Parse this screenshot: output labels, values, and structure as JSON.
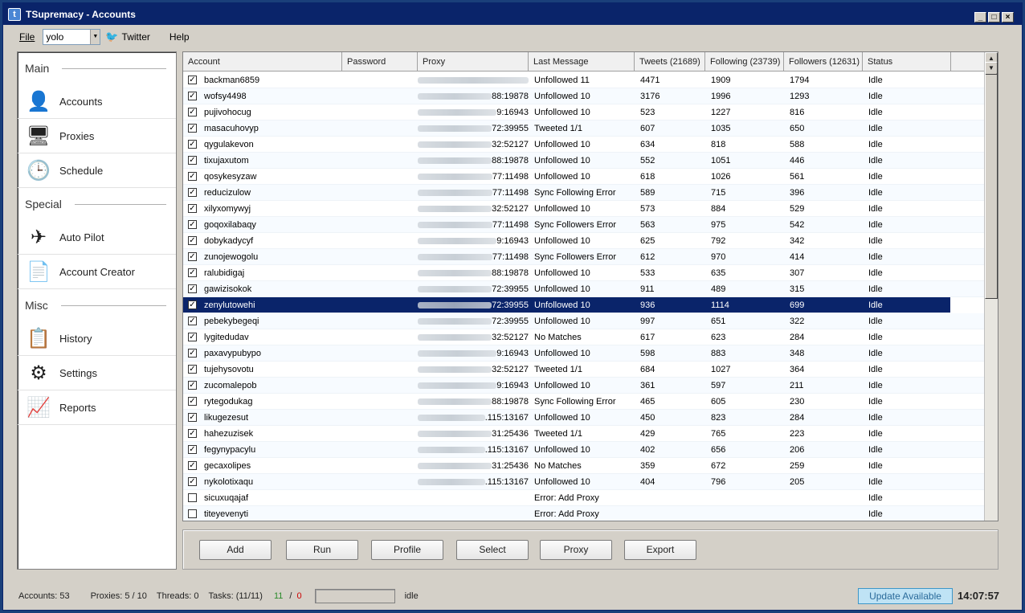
{
  "window": {
    "title": "TSupremacy - Accounts",
    "icon": "t-icon"
  },
  "menu": {
    "file": "File",
    "profile_value": "yolo",
    "twitter": "Twitter",
    "help": "Help"
  },
  "sidebar": {
    "sections": [
      {
        "title": "Main",
        "items": [
          {
            "label": "Accounts",
            "icon": "user-icon"
          },
          {
            "label": "Proxies",
            "icon": "computer-icon"
          },
          {
            "label": "Schedule",
            "icon": "clock-icon"
          }
        ]
      },
      {
        "title": "Special",
        "items": [
          {
            "label": "Auto Pilot",
            "icon": "airplane-icon"
          },
          {
            "label": "Account Creator",
            "icon": "documents-icon"
          }
        ]
      },
      {
        "title": "Misc",
        "items": [
          {
            "label": "History",
            "icon": "clipboard-icon"
          },
          {
            "label": "Settings",
            "icon": "gears-icon"
          },
          {
            "label": "Reports",
            "icon": "chart-icon"
          }
        ]
      }
    ]
  },
  "grid": {
    "columns": [
      "Account",
      "Password",
      "Proxy",
      "Last Message",
      "Tweets (21689)",
      "Following (23739)",
      "Followers (12631)",
      "Status"
    ],
    "rows": [
      {
        "checked": true,
        "account": "backman6859",
        "proxy": "",
        "message": "Unfollowed 11",
        "tweets": "4471",
        "following": "1909",
        "followers": "1794",
        "status": "Idle"
      },
      {
        "checked": true,
        "account": "wofsy4498",
        "proxy": "88:19878",
        "message": "Unfollowed 10",
        "tweets": "3176",
        "following": "1996",
        "followers": "1293",
        "status": "Idle"
      },
      {
        "checked": true,
        "account": "pujivohocug",
        "proxy": "9:16943",
        "message": "Unfollowed 10",
        "tweets": "523",
        "following": "1227",
        "followers": "816",
        "status": "Idle"
      },
      {
        "checked": true,
        "account": "masacuhovyp",
        "proxy": "72:39955",
        "message": "Tweeted 1/1",
        "tweets": "607",
        "following": "1035",
        "followers": "650",
        "status": "Idle"
      },
      {
        "checked": true,
        "account": "qygulakevon",
        "proxy": "32:52127",
        "message": "Unfollowed 10",
        "tweets": "634",
        "following": "818",
        "followers": "588",
        "status": "Idle"
      },
      {
        "checked": true,
        "account": "tixujaxutom",
        "proxy": "88:19878",
        "message": "Unfollowed 10",
        "tweets": "552",
        "following": "1051",
        "followers": "446",
        "status": "Idle"
      },
      {
        "checked": true,
        "account": "qosykesyzaw",
        "proxy": "77:11498",
        "message": "Unfollowed 10",
        "tweets": "618",
        "following": "1026",
        "followers": "561",
        "status": "Idle"
      },
      {
        "checked": true,
        "account": "reducizulow",
        "proxy": "77:11498",
        "message": "Sync Following Error",
        "tweets": "589",
        "following": "715",
        "followers": "396",
        "status": "Idle"
      },
      {
        "checked": true,
        "account": "xilyxomywyj",
        "proxy": "32:52127",
        "message": "Unfollowed 10",
        "tweets": "573",
        "following": "884",
        "followers": "529",
        "status": "Idle"
      },
      {
        "checked": true,
        "account": "goqoxilabaqy",
        "proxy": "77:11498",
        "message": "Sync Followers Error",
        "tweets": "563",
        "following": "975",
        "followers": "542",
        "status": "Idle"
      },
      {
        "checked": true,
        "account": "dobykadycyf",
        "proxy": "9:16943",
        "message": "Unfollowed 10",
        "tweets": "625",
        "following": "792",
        "followers": "342",
        "status": "Idle"
      },
      {
        "checked": true,
        "account": "zunojewogolu",
        "proxy": "77:11498",
        "message": "Sync Followers Error",
        "tweets": "612",
        "following": "970",
        "followers": "414",
        "status": "Idle"
      },
      {
        "checked": true,
        "account": "ralubidigaj",
        "proxy": "88:19878",
        "message": "Unfollowed 10",
        "tweets": "533",
        "following": "635",
        "followers": "307",
        "status": "Idle"
      },
      {
        "checked": true,
        "account": "gawizisokok",
        "proxy": "72:39955",
        "message": "Unfollowed 10",
        "tweets": "911",
        "following": "489",
        "followers": "315",
        "status": "Idle"
      },
      {
        "checked": true,
        "account": "zenylutowehi",
        "proxy": "72:39955",
        "message": "Unfollowed 10",
        "tweets": "936",
        "following": "1114",
        "followers": "699",
        "status": "Idle",
        "selected": true
      },
      {
        "checked": true,
        "account": "pebekybegeqi",
        "proxy": "72:39955",
        "message": "Unfollowed 10",
        "tweets": "997",
        "following": "651",
        "followers": "322",
        "status": "Idle"
      },
      {
        "checked": true,
        "account": "lygitedudav",
        "proxy": "32:52127",
        "message": "No Matches",
        "tweets": "617",
        "following": "623",
        "followers": "284",
        "status": "Idle"
      },
      {
        "checked": true,
        "account": "paxavypubypo",
        "proxy": "9:16943",
        "message": "Unfollowed 10",
        "tweets": "598",
        "following": "883",
        "followers": "348",
        "status": "Idle"
      },
      {
        "checked": true,
        "account": "tujehysovotu",
        "proxy": "32:52127",
        "message": "Tweeted 1/1",
        "tweets": "684",
        "following": "1027",
        "followers": "364",
        "status": "Idle"
      },
      {
        "checked": true,
        "account": "zucomalepob",
        "proxy": "9:16943",
        "message": "Unfollowed 10",
        "tweets": "361",
        "following": "597",
        "followers": "211",
        "status": "Idle"
      },
      {
        "checked": true,
        "account": "rytegodukag",
        "proxy": "88:19878",
        "message": "Sync Following Error",
        "tweets": "465",
        "following": "605",
        "followers": "230",
        "status": "Idle"
      },
      {
        "checked": true,
        "account": "likugezesut",
        "proxy": ".115:13167",
        "message": "Unfollowed 10",
        "tweets": "450",
        "following": "823",
        "followers": "284",
        "status": "Idle"
      },
      {
        "checked": true,
        "account": "hahezuzisek",
        "proxy": "31:25436",
        "message": "Tweeted 1/1",
        "tweets": "429",
        "following": "765",
        "followers": "223",
        "status": "Idle"
      },
      {
        "checked": true,
        "account": "fegynypacylu",
        "proxy": ".115:13167",
        "message": "Unfollowed 10",
        "tweets": "402",
        "following": "656",
        "followers": "206",
        "status": "Idle"
      },
      {
        "checked": true,
        "account": "gecaxolipes",
        "proxy": "31:25436",
        "message": "No Matches",
        "tweets": "359",
        "following": "672",
        "followers": "259",
        "status": "Idle"
      },
      {
        "checked": true,
        "account": "nykolotixaqu",
        "proxy": ".115:13167",
        "message": "Unfollowed 10",
        "tweets": "404",
        "following": "796",
        "followers": "205",
        "status": "Idle"
      },
      {
        "checked": false,
        "account": "sicuxuqajaf",
        "proxy": "",
        "message": "Error: Add Proxy",
        "tweets": "",
        "following": "",
        "followers": "",
        "status": "Idle"
      },
      {
        "checked": false,
        "account": "titeyevenyti",
        "proxy": "",
        "message": "Error: Add Proxy",
        "tweets": "",
        "following": "",
        "followers": "",
        "status": "Idle"
      }
    ]
  },
  "buttons": [
    "Add",
    "Run",
    "Profile",
    "Select",
    "Proxy",
    "Export"
  ],
  "status": {
    "accounts": "Accounts: 53",
    "proxies": "Proxies: 5 / 10",
    "threads": "Threads: 0",
    "tasks": "Tasks: (11/11)",
    "ok_count": "11",
    "sep": "/",
    "fail_count": "0",
    "state": "idle",
    "update": "Update Available",
    "clock": "14:07:57"
  }
}
